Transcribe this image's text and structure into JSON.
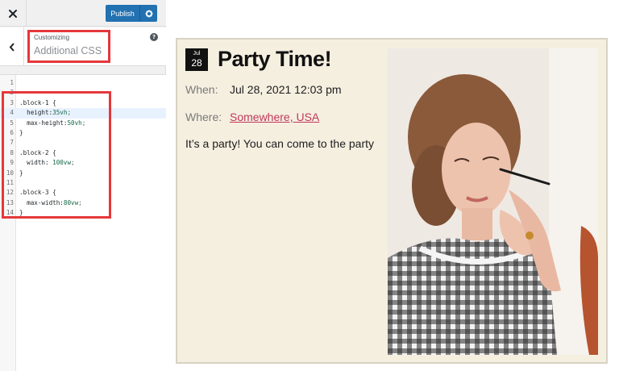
{
  "customizer": {
    "close_icon": "close-icon",
    "publish_label": "Publish",
    "settings_icon": "gear-icon",
    "back_icon": "chevron-left-icon",
    "sub_label": "Customizing",
    "section_title": "Additional CSS",
    "help_icon": "help-icon",
    "help_glyph": "?"
  },
  "editor": {
    "lines": [
      {
        "num": "1",
        "text": ""
      },
      {
        "num": "2",
        "text": ""
      },
      {
        "num": "3",
        "text": ".block-1 {"
      },
      {
        "num": "4",
        "text": "  height:35vh;"
      },
      {
        "num": "5",
        "text": "  max-height:50vh;"
      },
      {
        "num": "6",
        "text": "}"
      },
      {
        "num": "7",
        "text": ""
      },
      {
        "num": "8",
        "text": ".block-2 {"
      },
      {
        "num": "9",
        "text": "  width: 100vw;"
      },
      {
        "num": "10",
        "text": "}"
      },
      {
        "num": "11",
        "text": ""
      },
      {
        "num": "12",
        "text": ".block-3 {"
      },
      {
        "num": "13",
        "text": "  max-width:80vw;"
      },
      {
        "num": "14",
        "text": "}"
      }
    ],
    "active_line": "4"
  },
  "preview": {
    "date_month": "Jul",
    "date_day": "28",
    "title": "Party Time!",
    "when_label": "When:",
    "when_value": "Jul 28, 2021 12:03 pm",
    "where_label": "Where:",
    "where_value": "Somewhere, USA",
    "description": "It’s a party! You can come to the party"
  },
  "colors": {
    "accent": "#2271b1",
    "highlight_box": "#e5383b",
    "card_bg": "#f5efe0",
    "link": "#c0395a"
  }
}
